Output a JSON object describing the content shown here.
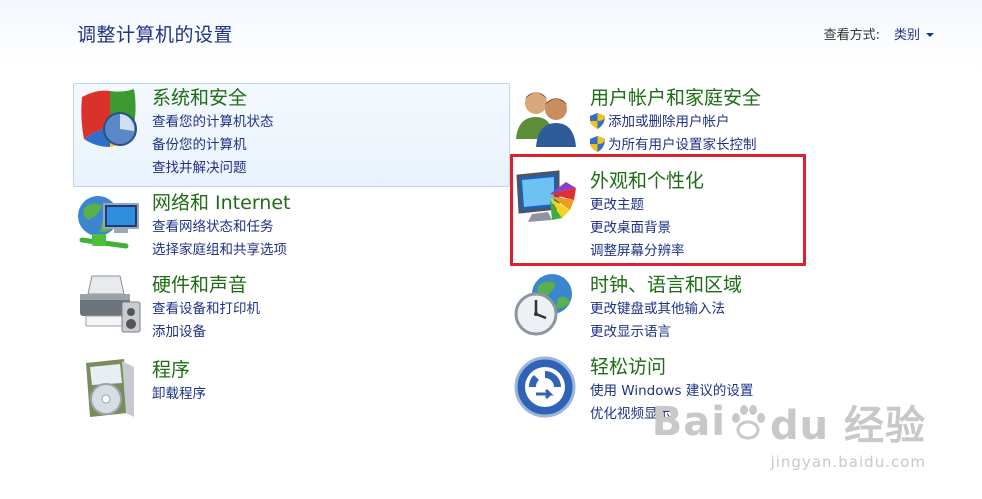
{
  "header": {
    "title": "调整计算机的设置",
    "view_label": "查看方式:",
    "view_value": "类别"
  },
  "categories": [
    {
      "title": "系统和安全",
      "links": [
        "查看您的计算机状态",
        "备份您的计算机",
        "查找并解决问题"
      ],
      "icon": "shield-icon"
    },
    {
      "title": "网络和 Internet",
      "links": [
        "查看网络状态和任务",
        "选择家庭组和共享选项"
      ],
      "icon": "network-globe-icon"
    },
    {
      "title": "硬件和声音",
      "links": [
        "查看设备和打印机",
        "添加设备"
      ],
      "icon": "printer-icon"
    },
    {
      "title": "程序",
      "links": [
        "卸载程序"
      ],
      "icon": "programs-icon"
    },
    {
      "title": "用户帐户和家庭安全",
      "links": [
        "添加或删除用户帐户",
        "为所有用户设置家长控制"
      ],
      "icon": "users-icon"
    },
    {
      "title": "外观和个性化",
      "links": [
        "更改主题",
        "更改桌面背景",
        "调整屏幕分辨率"
      ],
      "icon": "display-palette-icon"
    },
    {
      "title": "时钟、语言和区域",
      "links": [
        "更改键盘或其他输入法",
        "更改显示语言"
      ],
      "icon": "clock-globe-icon"
    },
    {
      "title": "轻松访问",
      "links": [
        "使用 Windows 建议的设置",
        "优化视频显示"
      ],
      "icon": "accessibility-icon"
    }
  ],
  "highlight_color": "#d9232f",
  "watermark": {
    "brand": "Bai  du 经验",
    "url": "jingyan.baidu.com"
  }
}
